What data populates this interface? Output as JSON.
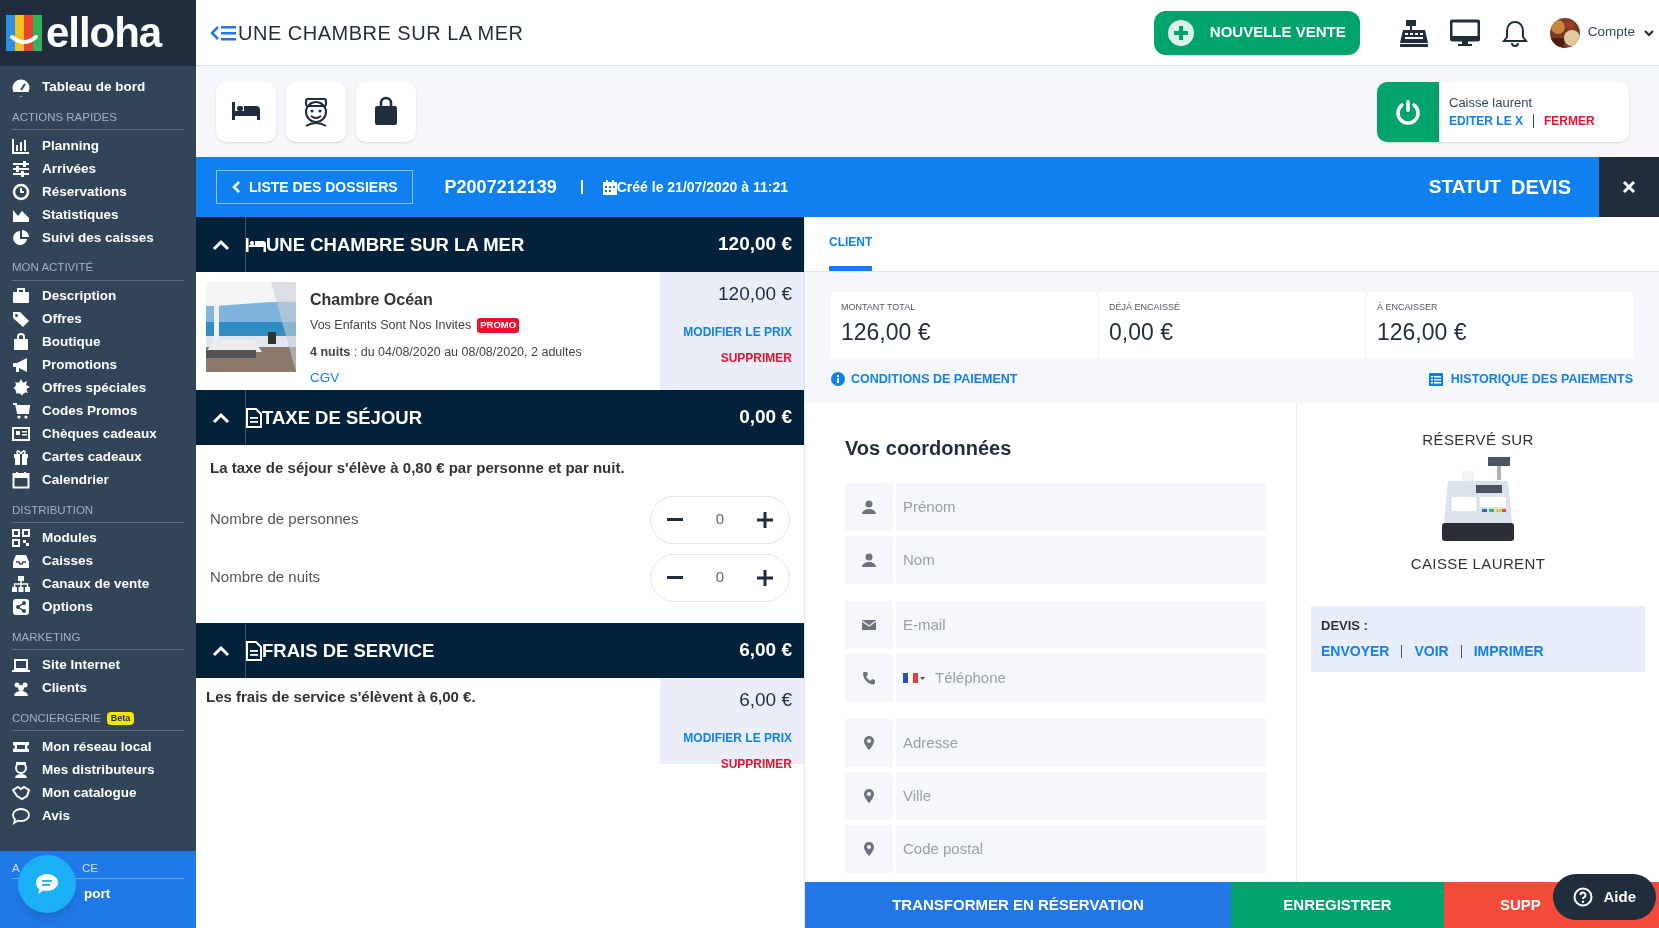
{
  "brand": "elloha",
  "header": {
    "title": "UNE CHAMBRE SUR LA MER",
    "new_sale_button": "NOUVELLE VENTE",
    "account": "Compte"
  },
  "sidebar": {
    "dashboard": "Tableau de bord",
    "sections": [
      {
        "title": "ACTIONS RAPIDES",
        "items": [
          "Planning",
          "Arrivées",
          "Réservations",
          "Statistiques",
          "Suivi des caisses"
        ]
      },
      {
        "title": "MON ACTIVITÉ",
        "items": [
          "Description",
          "Offres",
          "Boutique",
          "Promotions",
          "Offres spéciales",
          "Codes Promos",
          "Chèques cadeaux",
          "Cartes cadeaux",
          "Calendrier"
        ]
      },
      {
        "title": "DISTRIBUTION",
        "items": [
          "Modules",
          "Caisses",
          "Canaux de vente",
          "Options"
        ]
      },
      {
        "title": "MARKETING",
        "items": [
          "Site Internet",
          "Clients"
        ]
      },
      {
        "title": "CONCIERGERIE",
        "badge": "Beta",
        "items": [
          "Mon réseau local",
          "Mes distributeurs",
          "Mon catalogue",
          "Avis"
        ]
      }
    ],
    "assistance": {
      "title_start": "A",
      "title_end": "CE",
      "item": "port"
    }
  },
  "cash_register": {
    "name": "Caisse laurent",
    "edit": "EDITER LE X",
    "close": "FERMER"
  },
  "file_bar": {
    "back": "LISTE DES DOSSIERS",
    "number": "P2007212139",
    "created": "Créé le 21/07/2020 à 11:21",
    "status_label": "STATUT",
    "status": "DEVIS"
  },
  "cart": [
    {
      "kind": "room",
      "title": "UNE CHAMBRE SUR LA MER",
      "total": "120,00 €",
      "name": "Chambre Océan",
      "offer": "Vos Enfants Sont Nos Invites",
      "promo": "PROMO",
      "details": "**4 nuits** : du 04/08/2020 au 08/08/2020, 2 adultes",
      "link": "CGV",
      "price": "120,00 €",
      "edit": "MODIFIER LE PRIX",
      "delete": "SUPPRIMER"
    },
    {
      "kind": "tax",
      "title": "TAXE DE SÉJOUR",
      "total": "0,00 €",
      "note": "La taxe de séjour s'élève à 0,80 € par personne et par nuit.",
      "counters": [
        {
          "label": "Nombre de personnes",
          "value": "0"
        },
        {
          "label": "Nombre de nuits",
          "value": "0"
        }
      ]
    },
    {
      "kind": "fee",
      "title": "FRAIS DE SERVICE",
      "total": "6,00 €",
      "note": "Les frais de service s'élèvent à 6,00 €.",
      "price": "6,00 €",
      "edit": "MODIFIER LE PRIX",
      "delete": "SUPPRIMER"
    }
  ],
  "tabs": [
    {
      "label": "CLIENT",
      "selected": true
    }
  ],
  "payment": {
    "cards": [
      {
        "label": "MONTANT TOTAL",
        "value": "126,00 €"
      },
      {
        "label": "DÉJÀ ENCAISSÉ",
        "value": "0,00 €"
      },
      {
        "label": "À ENCAISSER",
        "value": "126,00 €"
      }
    ],
    "conditions": "CONDITIONS DE PAIEMENT",
    "history": "HISTORIQUE DES PAIEMENTS"
  },
  "form": {
    "title": "Vos coordonnées",
    "field_groups": [
      [
        {
          "kind": "person",
          "placeholder": "Prénom"
        },
        {
          "kind": "person",
          "placeholder": "Nom"
        }
      ],
      [
        {
          "kind": "email",
          "placeholder": "E-mail"
        },
        {
          "kind": "phone",
          "placeholder": "Téléphone"
        }
      ],
      [
        {
          "kind": "location",
          "placeholder": "Adresse"
        },
        {
          "kind": "location",
          "placeholder": "Ville"
        },
        {
          "kind": "location",
          "placeholder": "Code postal"
        }
      ]
    ]
  },
  "booked_on": {
    "title": "RÉSERVÉ SUR",
    "name": "CAISSE LAURENT",
    "quote_label": "DEVIS :",
    "actions": [
      "ENVOYER",
      "VOIR",
      "IMPRIMER"
    ]
  },
  "actions": [
    {
      "kind": "primary",
      "label": "TRANSFORMER EN RÉSERVATION"
    },
    {
      "kind": "save",
      "label": "ENREGISTRER"
    },
    {
      "kind": "danger",
      "label": "SUPP"
    }
  ],
  "help_button": "Aide"
}
